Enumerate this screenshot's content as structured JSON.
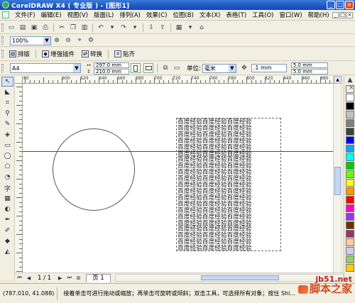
{
  "window": {
    "title": "CorelDRAW X4 ( 专业版 ) - [图形1]",
    "controls": [
      "_",
      "□",
      "×"
    ]
  },
  "menu": {
    "items": [
      "文件(F)",
      "编辑(E)",
      "视图(V)",
      "版面(L)",
      "排列(A)",
      "效果(C)",
      "位图(B)",
      "文本(X)",
      "表格(T)",
      "工具(O)",
      "窗口(W)",
      "帮助(H)"
    ]
  },
  "toolbar1": {
    "icons": [
      "new-icon",
      "open-icon",
      "save-icon",
      "print-icon",
      "cut-icon",
      "copy-icon",
      "paste-icon",
      "undo-icon",
      "redo-icon",
      "import-icon",
      "export-icon",
      "application-launcher-icon",
      "welcome-icon"
    ]
  },
  "zoom": {
    "value": "100%"
  },
  "plugins": {
    "items": [
      "排版",
      "增强插件",
      "转换",
      "贴齐"
    ]
  },
  "property_bar": {
    "paper": "A4",
    "width": "297.0 mm",
    "height": "210.0 mm",
    "unit_label": "单位:",
    "unit": "毫米",
    "nudge": ".1 mm",
    "dup_x": "5.0 mm",
    "dup_y": "5.0 mm"
  },
  "ruler": {
    "h_labels": [
      "80",
      "600",
      "620",
      "640",
      "660",
      "680",
      "700",
      "720",
      "740",
      "760",
      "780",
      "800",
      "820",
      "840",
      "860",
      "880",
      "900"
    ],
    "v_labels": [
      "60",
      "40",
      "20",
      "0",
      "80",
      "60",
      "40",
      "20"
    ]
  },
  "canvas": {
    "text_line": "百度经验百度经验百度经验",
    "line_count": 21
  },
  "palette": {
    "colors": [
      "#ffffff",
      "#000000",
      "#c0c0c0",
      "#808080",
      "#404040",
      "#0000ff",
      "#00aaff",
      "#00ffff",
      "#00cc00",
      "#66ff00",
      "#ffff00",
      "#ff9900",
      "#ff0000",
      "#ff00cc",
      "#9933ff",
      "#663300",
      "#993366",
      "#ffcc99",
      "#ccccff",
      "#99cc66",
      "#ffcc00"
    ]
  },
  "navigator": {
    "page_counter": "1 / 1",
    "page_tab": "页 1"
  },
  "status": {
    "coords": "(787.010, 41.088)",
    "hint": "接着单击可进行拖动或缩放；再单击可旋转或倾斜；双击工具，可选择所有对象；按住 Shi..."
  },
  "watermark": {
    "url": "jb51.net",
    "name": "脚本之家"
  }
}
